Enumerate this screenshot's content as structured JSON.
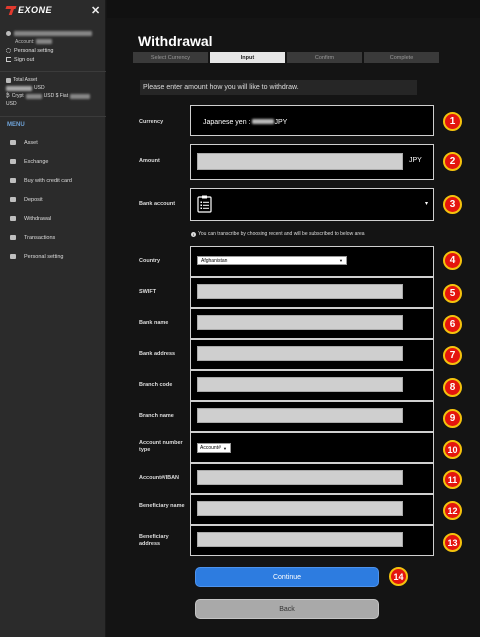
{
  "sidebar": {
    "logo": "EXONE",
    "close": "✕",
    "user": {
      "account_label": "Account:",
      "personal_setting": "Personal setting",
      "sign_out": "Sign out"
    },
    "assets": {
      "total_label": "Total Asset",
      "total_unit": "USD",
      "crypt_label": "Crypt",
      "crypt_unit": "USD $ Fiat",
      "fiat_unit": "USD"
    },
    "menu_label": "MENU",
    "menu": [
      {
        "label": "Asset",
        "icon": "wallet-icon"
      },
      {
        "label": "Exchange",
        "icon": "exchange-icon"
      },
      {
        "label": "Buy with credit card",
        "icon": "cart-icon"
      },
      {
        "label": "Deposit",
        "icon": "deposit-icon"
      },
      {
        "label": "Withdrawal",
        "icon": "withdrawal-icon"
      },
      {
        "label": "Transactions",
        "icon": "transactions-icon"
      },
      {
        "label": "Personal setting",
        "icon": "person-icon"
      }
    ]
  },
  "main": {
    "title": "Withdrawal",
    "steps": [
      "Select Currency",
      "Input",
      "Confirm",
      "Complete"
    ],
    "instruction": "Please enter amount how you will like to withdraw.",
    "currency_label": "Currency",
    "currency_prefix": "Japanese yen : ",
    "currency_suffix": "JPY",
    "amount_label": "Amount",
    "amount_unit": "JPY",
    "bank_account_label": "Bank account",
    "bank_caret": "▾",
    "hint": "You can transcribe by choosing recent and will be subscribed to below area",
    "country_label": "Country",
    "country_value": "Afghanistan",
    "swift_label": "SWIFT",
    "bank_name_label": "Bank name",
    "bank_address_label": "Bank address",
    "branch_code_label": "Branch code",
    "branch_name_label": "Branch name",
    "account_number_type_label": "Account number type",
    "account_type_value": "Account#",
    "account_iban_label": "Account#/IBAN",
    "beneficiary_name_label": "Beneficiary name",
    "beneficiary_address_label": "Beneficiary address",
    "continue": "Continue",
    "back": "Back"
  },
  "badges": [
    "1",
    "2",
    "3",
    "4",
    "5",
    "6",
    "7",
    "8",
    "9",
    "10",
    "11",
    "12",
    "13",
    "14"
  ],
  "colors": {
    "badge": "#e4150e",
    "badge_border": "#f4c20d",
    "continue": "#2d7ce0",
    "menu_label": "#6fa3d8"
  }
}
